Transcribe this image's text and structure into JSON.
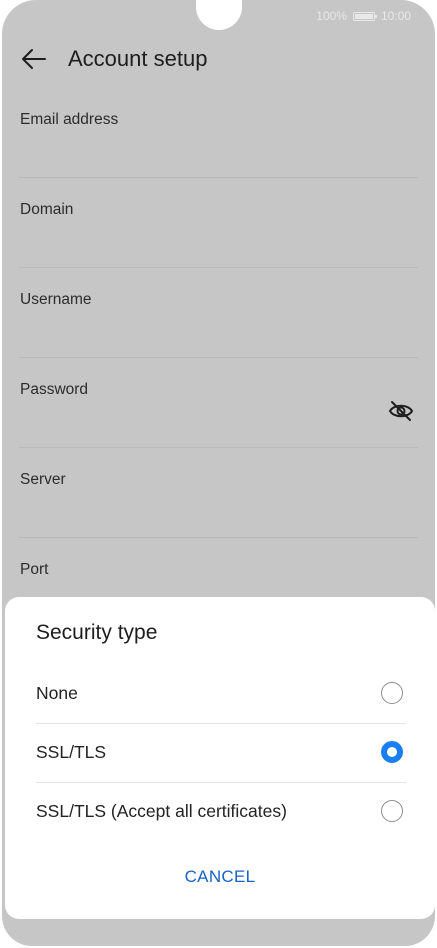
{
  "status_bar": {
    "battery_percent": "100%",
    "time": "10:00"
  },
  "app_bar": {
    "back_icon": "arrow-left-icon",
    "title": "Account setup"
  },
  "form": {
    "fields": [
      {
        "label": "Email address"
      },
      {
        "label": "Domain"
      },
      {
        "label": "Username"
      },
      {
        "label": "Password",
        "icon": "eye-off-icon"
      },
      {
        "label": "Server"
      },
      {
        "label": "Port"
      }
    ]
  },
  "security_dialog": {
    "title": "Security type",
    "options": [
      {
        "label": "None",
        "selected": false
      },
      {
        "label": "SSL/TLS",
        "selected": true
      },
      {
        "label": "SSL/TLS (Accept all certificates)",
        "selected": false
      }
    ],
    "cancel_label": "CANCEL",
    "accent_color": "#1a7ff1"
  }
}
